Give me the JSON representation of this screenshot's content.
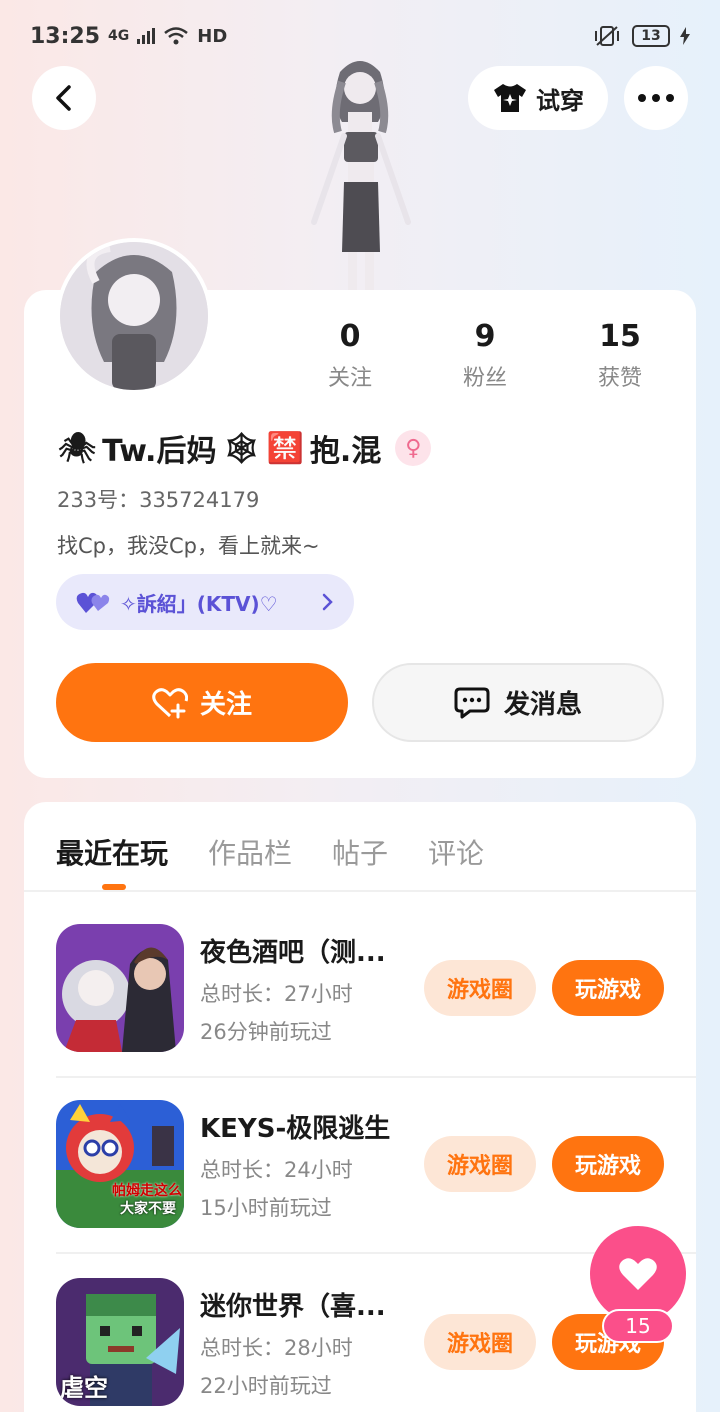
{
  "status_bar": {
    "time": "13:25",
    "network": "4G",
    "hd": "HD",
    "battery": "13"
  },
  "header": {
    "tryon_label": "试穿"
  },
  "profile": {
    "stats": [
      {
        "value": "0",
        "label": "关注"
      },
      {
        "value": "9",
        "label": "粉丝"
      },
      {
        "value": "15",
        "label": "获赞"
      }
    ],
    "username_prefix": "🕷",
    "username_a": "Tw.后妈",
    "username_web": "🕸",
    "username_ban": "🈲",
    "username_b": "抱.混",
    "gender_symbol": "♀",
    "account_id": "233号：335724179",
    "bio": "找Cp，我没Cp，看上就来~",
    "tag_label": "✧訴紹」(KTV)♡",
    "follow_label": "关注",
    "message_label": "发消息"
  },
  "tabs": [
    {
      "label": "最近在玩"
    },
    {
      "label": "作品栏"
    },
    {
      "label": "帖子"
    },
    {
      "label": "评论"
    }
  ],
  "games": [
    {
      "title": "夜色酒吧（测...",
      "duration": "总时长：27小时",
      "last_played": "26分钟前玩过",
      "circle_label": "游戏圈",
      "play_label": "玩游戏"
    },
    {
      "title": "KEYS-极限逃生",
      "duration": "总时长：24小时",
      "last_played": "15小时前玩过",
      "circle_label": "游戏圈",
      "play_label": "玩游戏",
      "icon_text_1": "帕姆走这么",
      "icon_text_2": "大家不要"
    },
    {
      "title": "迷你世界（喜...",
      "duration": "总时长：28小时",
      "last_played": "22小时前玩过",
      "circle_label": "游戏圈",
      "play_label": "玩游戏",
      "icon_text": "虐空"
    }
  ],
  "like_fab": {
    "count": "15"
  },
  "colors": {
    "accent": "#ff7410",
    "like": "#fb4f8a",
    "tag_bg": "#e9e9fb",
    "tag_fg": "#5b52d6"
  }
}
